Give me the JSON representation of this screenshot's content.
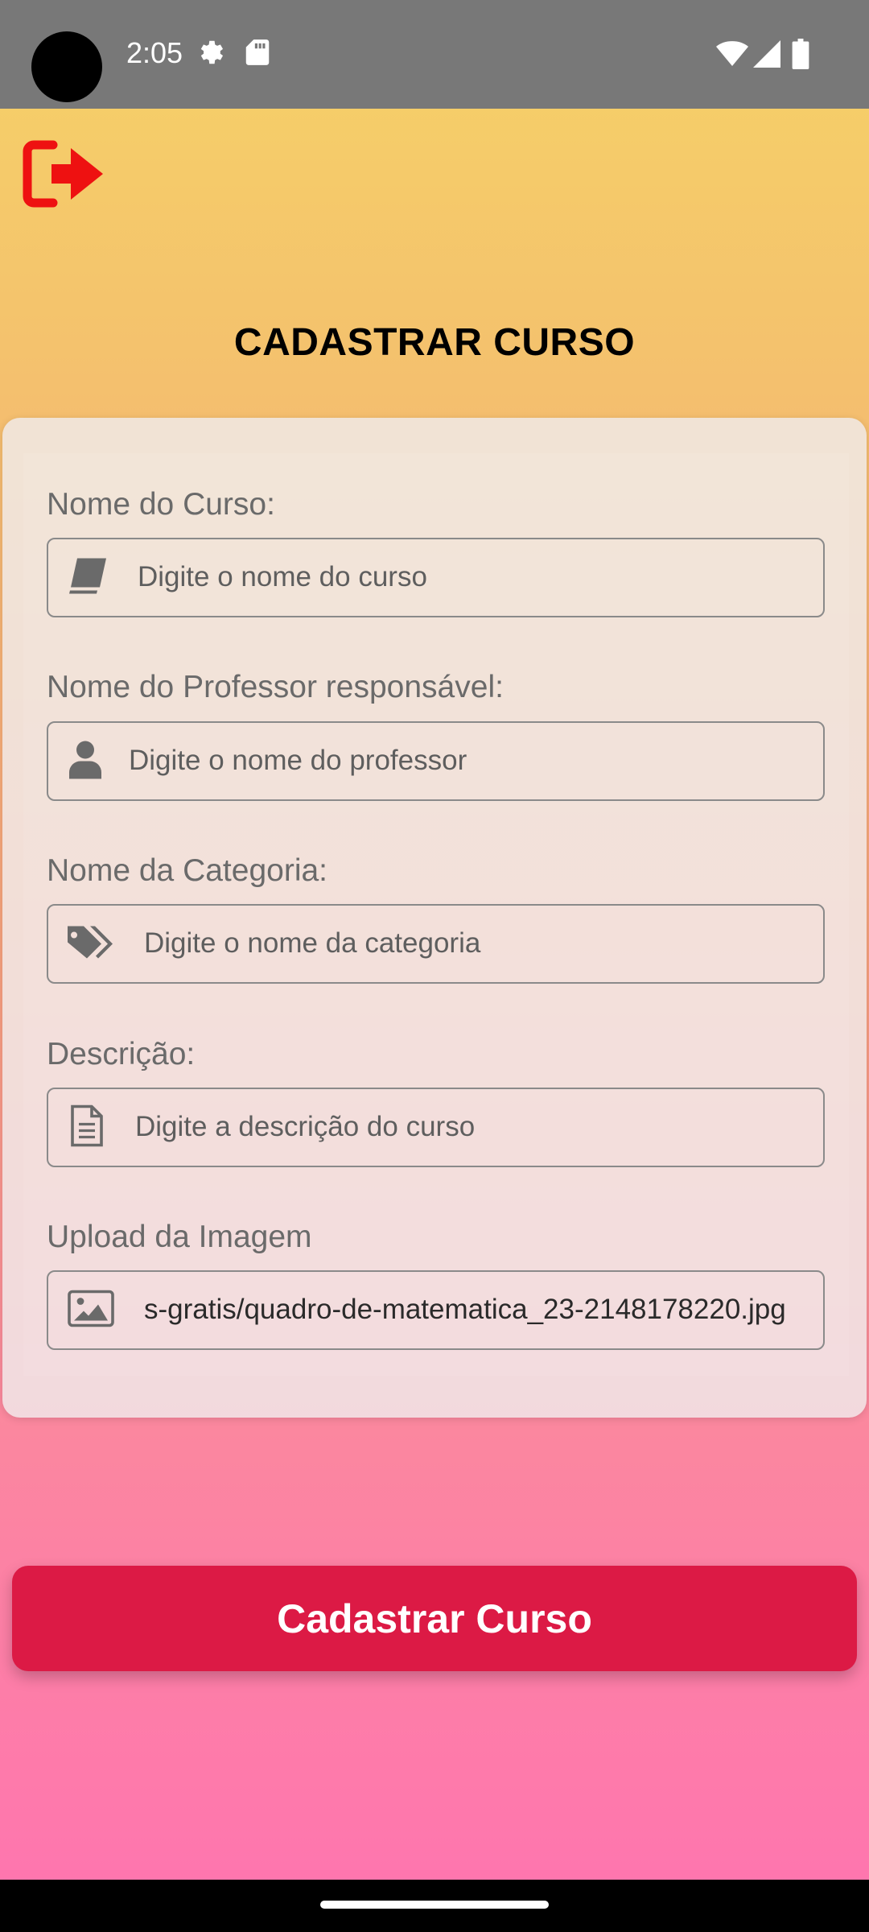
{
  "status_bar": {
    "time": "2:05",
    "icons": [
      "settings-icon",
      "sd-card-icon",
      "wifi-icon",
      "signal-icon",
      "battery-icon"
    ]
  },
  "header": {
    "logout_icon": "logout-icon",
    "title": "CADASTRAR CURSO"
  },
  "form": {
    "course_name": {
      "label": "Nome do Curso:",
      "placeholder": "Digite o nome do curso",
      "value": "",
      "icon": "book-icon"
    },
    "teacher_name": {
      "label": "Nome do Professor responsável:",
      "placeholder": "Digite o nome do professor",
      "value": "",
      "icon": "user-icon"
    },
    "category_name": {
      "label": "Nome da Categoria:",
      "placeholder": "Digite o nome da categoria",
      "value": "",
      "icon": "tags-icon"
    },
    "description": {
      "label": "Descrição:",
      "placeholder": "Digite a descrição do curso",
      "value": "",
      "icon": "document-icon"
    },
    "image_upload": {
      "label": "Upload da Imagem",
      "value": "s-gratis/quadro-de-matematica_23-2148178220.jpg",
      "icon": "image-icon"
    }
  },
  "actions": {
    "submit_label": "Cadastrar Curso"
  },
  "colors": {
    "accent": "#dc1a45",
    "logout": "#ee1111",
    "status_bar": "#787878"
  }
}
